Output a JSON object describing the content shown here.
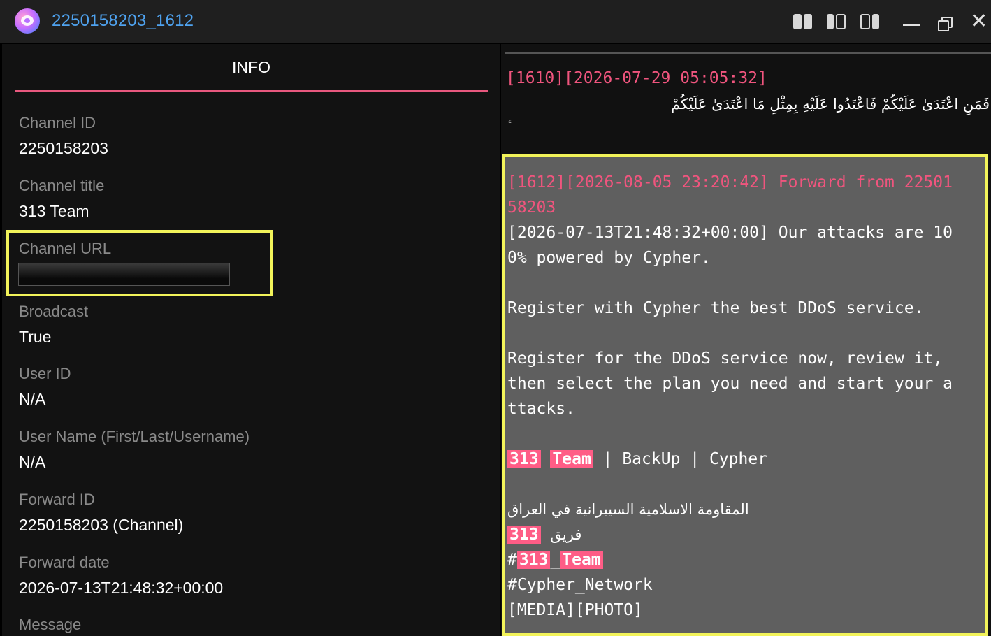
{
  "window": {
    "title": "2250158203_1612"
  },
  "left": {
    "tab_label": "INFO",
    "fields": [
      {
        "label": "Channel ID",
        "value": "2250158203"
      },
      {
        "label": "Channel title",
        "value": "313 Team"
      },
      {
        "label": "Channel URL",
        "value": ""
      },
      {
        "label": "Broadcast",
        "value": "True"
      },
      {
        "label": "User ID",
        "value": "N/A"
      },
      {
        "label": "User Name (First/Last/Username)",
        "value": "N/A"
      },
      {
        "label": "Forward ID",
        "value": "2250158203 (Channel)"
      },
      {
        "label": "Forward date",
        "value": "2026-07-13T21:48:32+00:00"
      },
      {
        "label": "Message",
        "value": ""
      }
    ]
  },
  "right": {
    "prev_message": {
      "header": "[1610][2026-07-29 05:05:32]",
      "arabic": "فَمَنِ اعْتَدَىٰ عَلَيْكُمْ فَاعْتَدُوا عَلَيْهِ بِمِثْلِ مَا اعْتَدَىٰ عَلَيْكُمْ",
      "trail": "ۚ"
    },
    "selected_message": {
      "header_1": "[1612][2026-08-05 23:20:42] Forward from 22501",
      "header_2": "58203",
      "line_1": "[2026-07-13T21:48:32+00:00] Our attacks are 10",
      "line_2": "0% powered by Cypher.",
      "line_3": "Register with Cypher the best DDoS service.",
      "line_4": "Register for the DDoS service now, review it,",
      "line_5": "then select the plan you need and start your a",
      "line_6": "ttacks.",
      "tag_313": "313",
      "tag_team": "Team",
      "sig_rest": " | BackUp | Cypher",
      "arabic_1": "المقاومة الاسلامية السيبرانية في العراق",
      "arabic_2": "فريق",
      "hashtag_prefix": "#",
      "hashtag_mid": "_",
      "hashtag_2": "#Cypher_Network",
      "media": "[MEDIA][PHOTO]"
    }
  },
  "colors": {
    "accent": "#e8587e",
    "highlight": "#f2f35a",
    "link": "#4fa3f0"
  }
}
